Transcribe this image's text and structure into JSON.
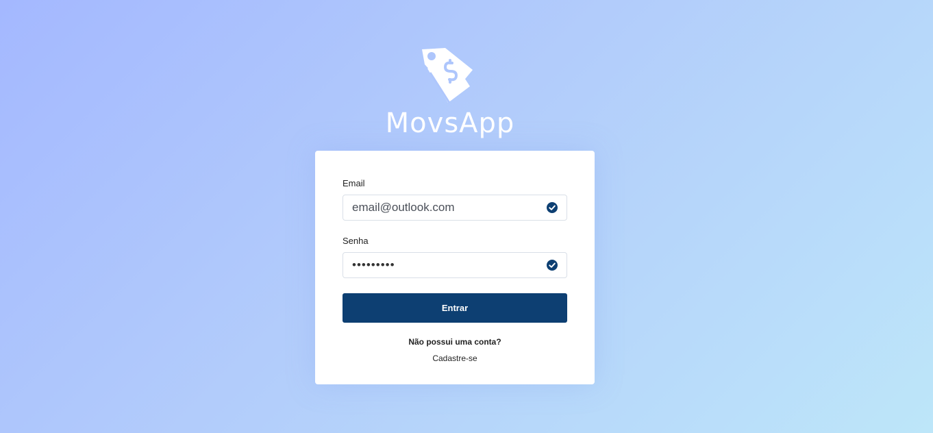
{
  "app": {
    "name": "MovsApp",
    "logo_icon": "price-tag-dollar-icon"
  },
  "login": {
    "email_label": "Email",
    "email_value": "email@outlook.com",
    "password_label": "Senha",
    "password_value": "passwordx",
    "submit_label": "Entrar",
    "no_account_text": "Não possui uma conta?",
    "signup_link": "Cadastre-se",
    "valid_icon": "check-circle-icon"
  },
  "colors": {
    "primary": "#0d3f72",
    "background_start": "#a4b8ff",
    "background_end": "#bde6f9",
    "card": "#ffffff"
  }
}
